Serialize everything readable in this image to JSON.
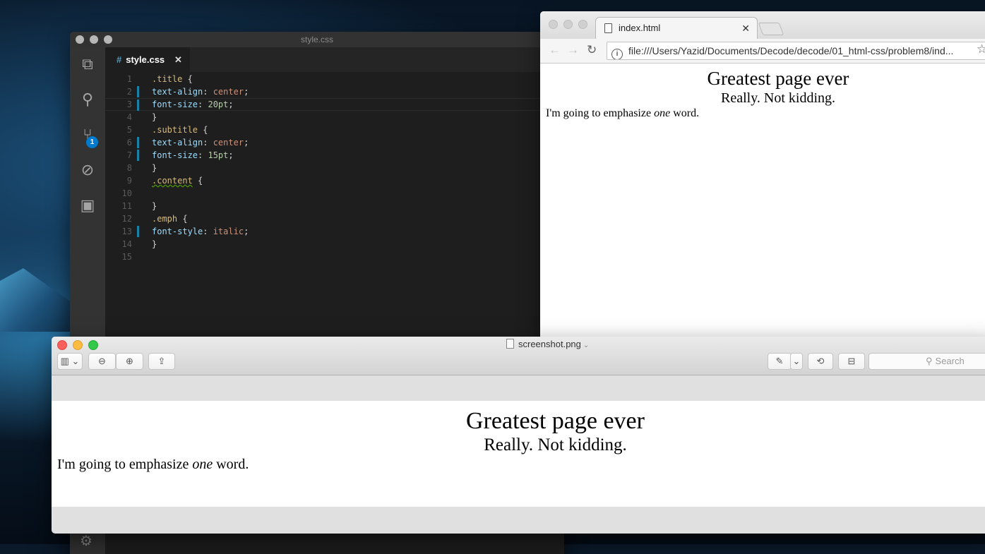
{
  "vscode": {
    "window_title": "style.css",
    "tab": {
      "icon": "#",
      "label": "style.css",
      "close": "✕"
    },
    "activity": {
      "explorer_icon": "⧉",
      "search_icon": "⚲",
      "scm_icon": "⑂",
      "scm_badge": "1",
      "debug_icon": "⊘",
      "extensions_icon": "▣"
    },
    "lines": [
      {
        "n": "1"
      },
      {
        "n": "2"
      },
      {
        "n": "3"
      },
      {
        "n": "4"
      },
      {
        "n": "5"
      },
      {
        "n": "6"
      },
      {
        "n": "7"
      },
      {
        "n": "8"
      },
      {
        "n": "9"
      },
      {
        "n": "10"
      },
      {
        "n": "11"
      },
      {
        "n": "12"
      },
      {
        "n": "13"
      },
      {
        "n": "14"
      },
      {
        "n": "15"
      }
    ],
    "code": {
      "title_sel": ".title",
      "subtitle_sel": ".subtitle",
      "content_sel": ".content",
      "emph_sel": ".emph",
      "open": " {",
      "close": "}",
      "prop_text_align": "text-align",
      "prop_font_size": "font-size",
      "prop_font_style": "font-style",
      "colon": ": ",
      "val_center": "center",
      "val_20pt": "20pt",
      "val_15pt": "15pt",
      "val_italic": "italic",
      "semi": ";"
    },
    "settings_icon": "⚙"
  },
  "chrome": {
    "tab_title": "index.html",
    "tab_close": "✕",
    "back": "←",
    "forward": "→",
    "reload": "↻",
    "info": "i",
    "url": "file:///Users/Yazid/Documents/Decode/decode/01_html-css/problem8/ind...",
    "star": "☆",
    "page": {
      "title": "Greatest page ever",
      "subtitle": "Really. Not kidding.",
      "text_before": "I'm going to emphasize ",
      "text_emph": "one",
      "text_after": " word."
    }
  },
  "preview": {
    "filename": "screenshot.png",
    "chevron": "⌄",
    "buttons": {
      "sidebar": "▥ ⌄",
      "zoom_out": "⊖",
      "zoom_in": "⊕",
      "share": "⇪",
      "markup": "✎",
      "markup_menu": "⌄",
      "rotate": "⟲",
      "toolbox": "⊟"
    },
    "search_placeholder": "Search",
    "search_icon": "⚲",
    "page": {
      "title": "Greatest page ever",
      "subtitle": "Really. Not kidding.",
      "text_before": "I'm going to emphasize ",
      "text_emph": "one",
      "text_after": " word."
    }
  }
}
